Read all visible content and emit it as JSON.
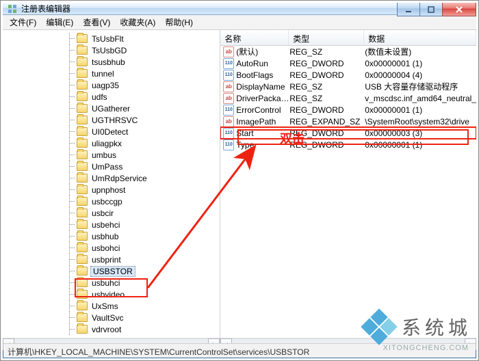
{
  "window": {
    "title": "注册表编辑器"
  },
  "menus": [
    {
      "label": "文件(F)"
    },
    {
      "label": "编辑(E)"
    },
    {
      "label": "查看(V)"
    },
    {
      "label": "收藏夹(A)"
    },
    {
      "label": "帮助(H)"
    }
  ],
  "tree_items": [
    "TsUsbFlt",
    "TsUsbGD",
    "tsusbhub",
    "tunnel",
    "uagp35",
    "udfs",
    "UGatherer",
    "UGTHRSVC",
    "UI0Detect",
    "uliagpkx",
    "umbus",
    "UmPass",
    "UmRdpService",
    "upnphost",
    "usbccgp",
    "usbcir",
    "usbehci",
    "usbhub",
    "usbohci",
    "usbprint",
    "USBSTOR",
    "usbuhci",
    "usbvideo",
    "UxSms",
    "VaultSvc",
    "vdrvroot"
  ],
  "tree_selected_index": 20,
  "list_columns": {
    "name": "名称",
    "type": "类型",
    "data": "数据"
  },
  "list_rows": [
    {
      "icon": "sz",
      "name": "(默认)",
      "type": "REG_SZ",
      "data": "(数值未设置)"
    },
    {
      "icon": "dw",
      "name": "AutoRun",
      "type": "REG_DWORD",
      "data": "0x00000001 (1)"
    },
    {
      "icon": "dw",
      "name": "BootFlags",
      "type": "REG_DWORD",
      "data": "0x00000004 (4)"
    },
    {
      "icon": "sz",
      "name": "DisplayName",
      "type": "REG_SZ",
      "data": "USB 大容量存储驱动程序"
    },
    {
      "icon": "sz",
      "name": "DriverPackageId",
      "type": "REG_SZ",
      "data": "v_mscdsc.inf_amd64_neutral_"
    },
    {
      "icon": "dw",
      "name": "ErrorControl",
      "type": "REG_DWORD",
      "data": "0x00000001 (1)"
    },
    {
      "icon": "sz",
      "name": "ImagePath",
      "type": "REG_EXPAND_SZ",
      "data": "\\SystemRoot\\system32\\drive"
    },
    {
      "icon": "dw",
      "name": "Start",
      "type": "REG_DWORD",
      "data": "0x00000003 (3)"
    },
    {
      "icon": "dw",
      "name": "Type",
      "type": "REG_DWORD",
      "data": "0x00000001 (1)"
    }
  ],
  "list_highlight_index": 7,
  "annotation_text": "双击",
  "statusbar_path": "计算机\\HKEY_LOCAL_MACHINE\\SYSTEM\\CurrentControlSet\\services\\USBSTOR",
  "watermark": {
    "brand": "系统城",
    "url": "XITONGCHENG.COM"
  }
}
